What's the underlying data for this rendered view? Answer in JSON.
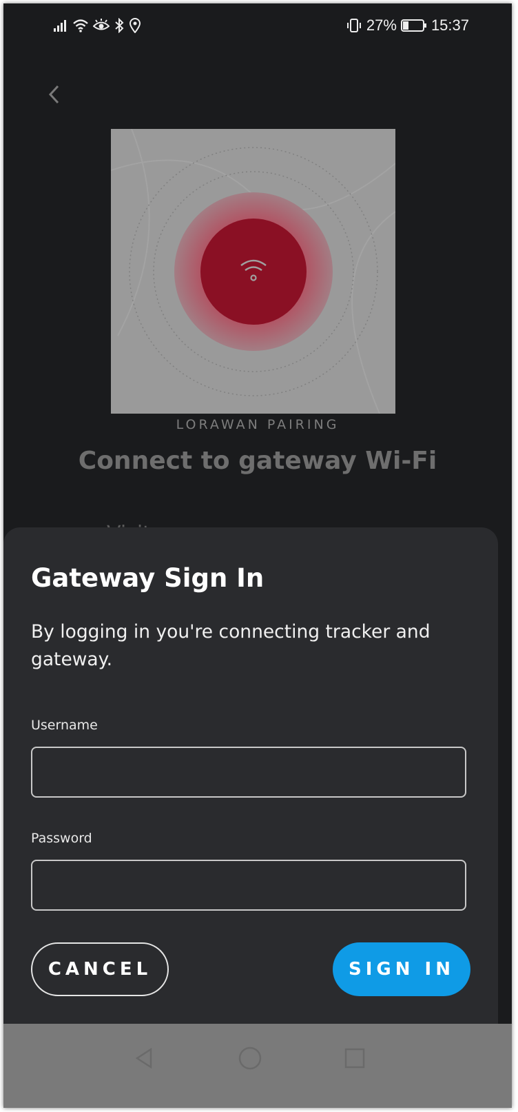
{
  "status_bar": {
    "battery_percent": "27%",
    "time": "15:37",
    "icons": [
      "signal-icon",
      "wifi-icon",
      "eye-icon",
      "bluetooth-icon",
      "location-icon",
      "vibrate-icon",
      "battery-icon"
    ]
  },
  "background_screen": {
    "kicker": "LORAWAN PAIRING",
    "title": "Connect to gateway Wi-Fi",
    "peek_text": "Visit ... "
  },
  "dialog": {
    "title": "Gateway Sign In",
    "description": "By logging in you're connecting tracker and gateway.",
    "username_label": "Username",
    "username_value": "",
    "password_label": "Password",
    "password_value": "",
    "cancel_label": "CANCEL",
    "signin_label": "SIGN IN"
  },
  "colors": {
    "accent": "#0f9be6",
    "sheet": "#2a2b2e",
    "background": "#1a1b1d",
    "hero_red": "#8a1024"
  }
}
